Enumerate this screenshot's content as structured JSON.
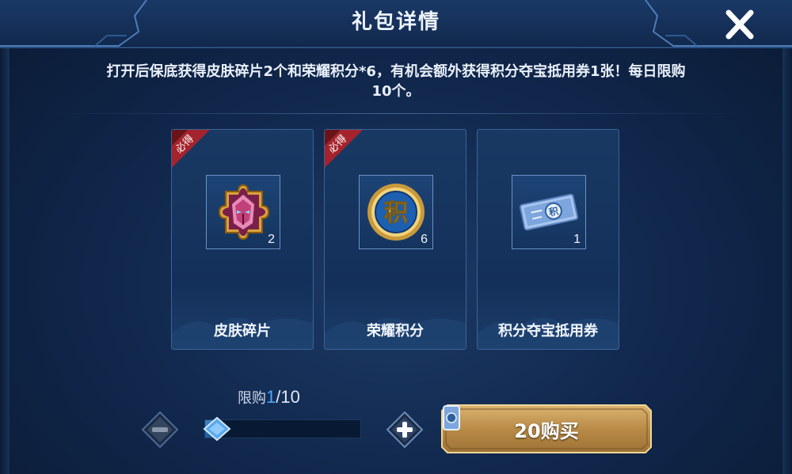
{
  "dialog": {
    "title": "礼包详情",
    "description_line1": "打开后保底获得皮肤碎片2个和荣耀积分*6，有机会额外获得积分夺宝抵用券1张！每日限购",
    "description_line2": "10个。"
  },
  "items": [
    {
      "name": "皮肤碎片",
      "quantity": "2",
      "badge": "必得",
      "icon": "skin-fragment-icon"
    },
    {
      "name": "荣耀积分",
      "quantity": "6",
      "badge": "必得",
      "icon": "glory-points-coin-icon"
    },
    {
      "name": "积分夺宝抵用券",
      "quantity": "1",
      "badge": "",
      "icon": "points-coupon-ticket-icon"
    }
  ],
  "purchase": {
    "limit_label": "限购",
    "current": "1",
    "separator_total": "/10",
    "progress_fraction": 0.1,
    "buy_label": "20购买"
  },
  "colors": {
    "accent_blue": "#4aa6ff",
    "badge_red": "#a5232d",
    "buy_gold": "#c9a25c"
  }
}
